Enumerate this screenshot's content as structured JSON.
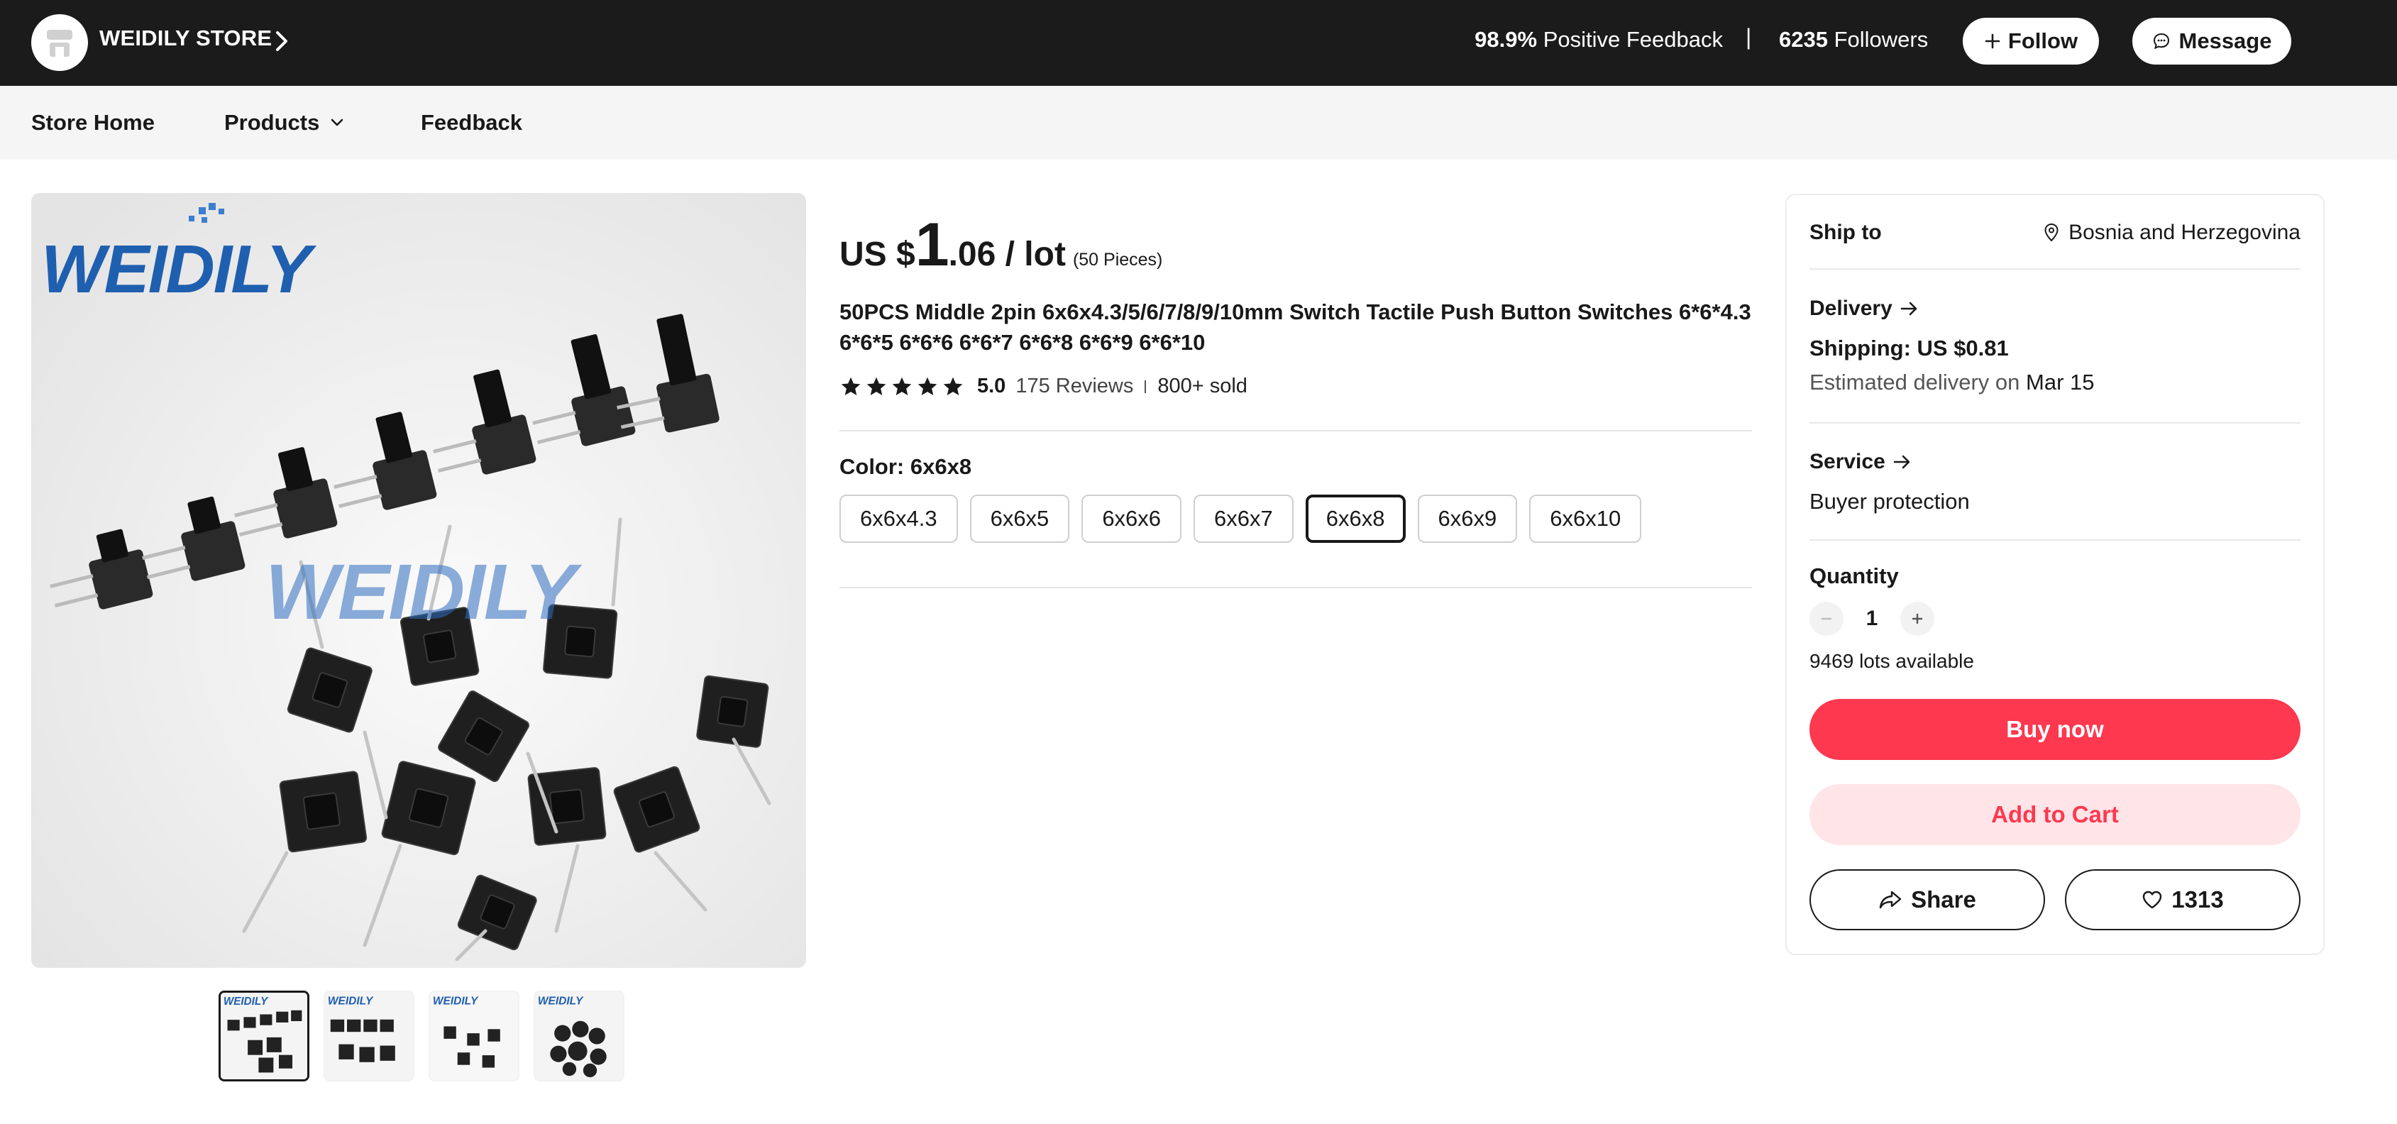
{
  "store": {
    "name": "WEIDILY STORE",
    "feedback_percent": "98.9%",
    "feedback_label": "Positive Feedback",
    "separator": "|",
    "followers_count": "6235",
    "followers_label": "Followers",
    "follow_label": "Follow",
    "message_label": "Message"
  },
  "nav": {
    "items": [
      {
        "label": "Store Home"
      },
      {
        "label": "Products"
      },
      {
        "label": "Feedback"
      }
    ]
  },
  "gallery": {
    "brand_watermark": "WEIDILY",
    "thumbnail_count": 4,
    "selected_thumbnail": 1
  },
  "product": {
    "price_currency": "US $",
    "price_whole": "1",
    "price_fraction": ".06 / lot",
    "pieces_note": "(50 Pieces)",
    "title": "50PCS Middle 2pin 6x6x4.3/5/6/7/8/9/10mm Switch Tactile Push Button Switches 6*6*4.3 6*6*5 6*6*6 6*6*7 6*6*8 6*6*9 6*6*10",
    "rating_value": "5.0",
    "star_count": 5,
    "reviews": "175 Reviews",
    "sold": "800+ sold",
    "color_label": "Color: 6x6x8",
    "options": [
      {
        "label": "6x6x4.3",
        "selected": false
      },
      {
        "label": "6x6x5",
        "selected": false
      },
      {
        "label": "6x6x6",
        "selected": false
      },
      {
        "label": "6x6x7",
        "selected": false
      },
      {
        "label": "6x6x8",
        "selected": true
      },
      {
        "label": "6x6x9",
        "selected": false
      },
      {
        "label": "6x6x10",
        "selected": false
      }
    ]
  },
  "panel": {
    "ship_to_label": "Ship to",
    "ship_to_location": "Bosnia and Herzegovina",
    "delivery_label": "Delivery",
    "shipping_text": "Shipping: US $0.81",
    "est_prefix": "Estimated delivery on",
    "est_date": "Mar 15",
    "service_label": "Service",
    "service_text": "Buyer protection",
    "quantity_label": "Quantity",
    "quantity_value": "1",
    "available_text": "9469 lots available",
    "buy_now_label": "Buy now",
    "add_to_cart_label": "Add to Cart",
    "share_label": "Share",
    "wishlist_count": "1313"
  },
  "colors": {
    "topbar_bg": "#1b1b1b",
    "nav_bg": "#f5f5f5",
    "accent_red": "#fd384f",
    "cart_bg": "#ffe5e8",
    "brand_blue": "#1f5fb0"
  },
  "icons": {
    "store_chevron": "chevron-right-icon",
    "follow": "plus-icon",
    "message": "chat-bubble-icon",
    "products_dropdown": "chevron-down-icon",
    "location": "map-pin-icon",
    "arrow": "arrow-right-icon",
    "qty_minus": "minus-icon",
    "qty_plus": "plus-icon",
    "share": "share-arrow-icon",
    "wishlist": "heart-icon",
    "rating": "star-icon"
  }
}
